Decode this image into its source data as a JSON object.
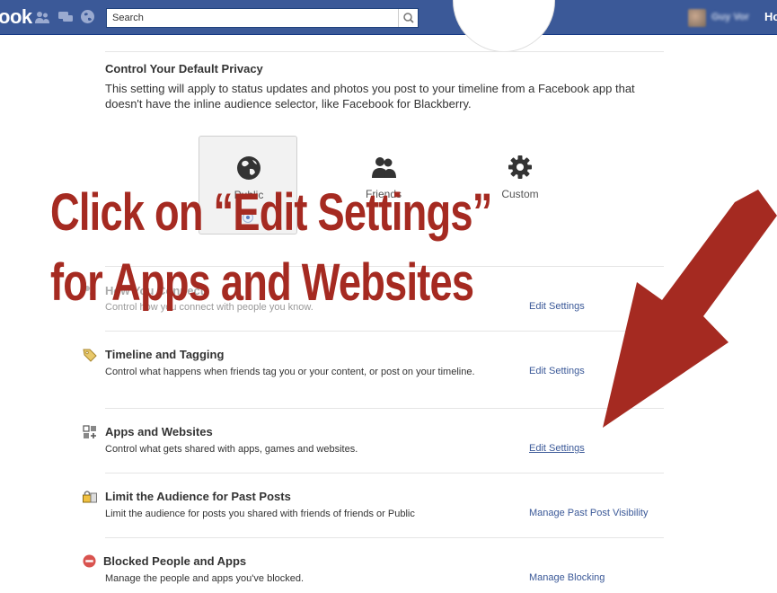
{
  "topbar": {
    "logo_text": "ook",
    "search_placeholder": "Search",
    "user_name": "Guy Vor",
    "home_label": "Ho",
    "brand_color": "#3b5998"
  },
  "privacy": {
    "title": "Control Your Default Privacy",
    "description": "This setting will apply to status updates and photos you post to your timeline from a Facebook app that doesn't have the inline audience selector, like Facebook for Blackberry.",
    "options": [
      {
        "label": "Public",
        "icon": "globe-icon",
        "selected": true
      },
      {
        "label": "Friends",
        "icon": "friends-icon",
        "selected": false
      },
      {
        "label": "Custom",
        "icon": "gear-icon",
        "selected": false
      }
    ]
  },
  "sections": [
    {
      "title": "How You Connect",
      "description": "Control how you connect with people you know.",
      "link": "Edit Settings",
      "icon": "connect-icon"
    },
    {
      "title": "Timeline and Tagging",
      "description": "Control what happens when friends tag you or your content, or post on your timeline.",
      "link": "Edit Settings",
      "icon": "tag-icon"
    },
    {
      "title": "Apps and Websites",
      "description": "Control what gets shared with apps, games and websites.",
      "link": "Edit Settings",
      "icon": "apps-icon"
    },
    {
      "title": "Limit the Audience for Past Posts",
      "description": "Limit the audience for posts you shared with friends of friends or Public",
      "link": "Manage Past Post Visibility",
      "icon": "lock-icon"
    },
    {
      "title": "Blocked People and Apps",
      "description": "Manage the people and apps you've blocked.",
      "link": "Manage Blocking",
      "icon": "blocked-icon"
    }
  ],
  "annotation": {
    "line1": "Click on “Edit Settings”",
    "line2": "for Apps and Websites",
    "color": "#a52a21"
  }
}
